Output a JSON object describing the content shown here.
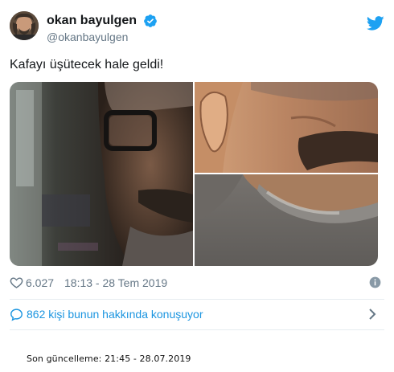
{
  "user": {
    "display_name": "okan bayulgen",
    "handle": "@okanbayulgen"
  },
  "icons": {
    "verified": "verified-badge-icon",
    "twitter": "twitter-bird-icon",
    "like": "heart-icon",
    "info": "info-icon",
    "conversation": "comment-bubble-icon",
    "chevron": "chevron-right-icon"
  },
  "tweet": {
    "text": "Kafayı üşütecek hale geldi!",
    "photos": [
      "photo-1",
      "photo-2",
      "photo-3"
    ]
  },
  "meta": {
    "likes": "6.027",
    "timestamp": "18:13 - 28 Tem 2019"
  },
  "conversation": {
    "text": "862 kişi bunun hakkında konuşuyor"
  },
  "footer": {
    "updated": "Son güncelleme: 21:45 - 28.07.2019"
  },
  "colors": {
    "brand_blue": "#1da1f2",
    "link_blue": "#1b95e0",
    "text_primary": "#14171a",
    "text_secondary": "#657786",
    "divider": "#e6ecf0"
  }
}
